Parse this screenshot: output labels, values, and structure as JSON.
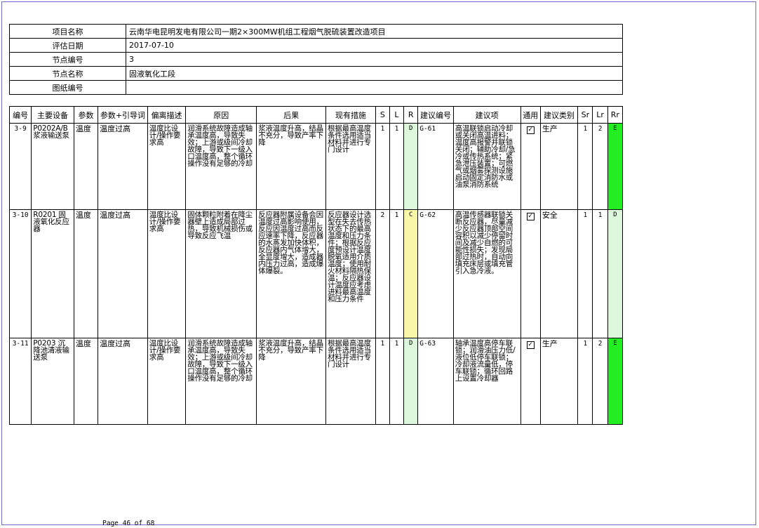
{
  "info": [
    {
      "label": "项目名称",
      "value": "云南华电昆明发电有限公司一期2×300MW机组工程烟气脱硫装置改造项目"
    },
    {
      "label": "评估日期",
      "value": "2017-07-10"
    },
    {
      "label": "节点编号",
      "value": "3"
    },
    {
      "label": "节点名称",
      "value": "固液氧化工段"
    },
    {
      "label": "图纸编号",
      "value": ""
    }
  ],
  "headers": [
    "编号",
    "主要设备",
    "参数",
    "参数+引导词",
    "偏离描述",
    "原因",
    "后果",
    "现有措施",
    "S",
    "L",
    "R",
    "建议编号",
    "建议项",
    "通用",
    "建议类别",
    "Sr",
    "Lr",
    "Rr"
  ],
  "rows": [
    {
      "id": "3-9",
      "equipment": "P0202A/B浆液输送泵",
      "param": "温度",
      "guideword": "温度过高",
      "deviation": "温度比设计/操作要求高",
      "cause": "润滑系统故障造成轴承温度高，导致失效；上游或级间冷却故障，导致下一级入口温度高，整个循环操作没有足够的冷却",
      "consequence": "浆液温度升高，结晶不充分，导致产率下降",
      "measures": "根据最高温度条件选用适当材料并进行专门设计",
      "S": "1",
      "L": "1",
      "R": "D",
      "rec_no": "G-61",
      "recommendation": "高温联锁启动冷却或关闭高温进料；温度高报警并联锁关闭；辅助冷却/急冷或传热系统；紧急泄压装置；可燃气或烟雾探测设施启动固定消防水或油泵消防系统",
      "general": "✓",
      "category": "生产",
      "Sr": "1",
      "Lr": "2",
      "Rr": "E",
      "R_color": "#ddf7dd",
      "Rr_color": "#22ee22"
    },
    {
      "id": "3-10",
      "equipment": "R0201 固液氧化反应器",
      "param": "温度",
      "guideword": "温度过高",
      "deviation": "温度比设计/操作要求高",
      "cause": "固体颗粒附着在降尘器壁上造成局部过热，导致机械损伤或导致反应飞温",
      "consequence": "反应器附属设备会因温度过高影响使用，反应因温度过高而反应速率下降，反应器的水蒸发加快体积，反应器内气体增大，全显度增大，造成器内压力过高，造成爆体爆裂。",
      "measures": "反应器设计选型在失去传热状态下的最高温度和压力条件；根据反应度预设计温度脱氧适用介质温度；使用耐火材料隔热保温；反应器设计温度应考虑进料最高温度和压力条件",
      "S": "2",
      "L": "1",
      "R": "C",
      "rec_no": "G-62",
      "recommendation": "高温传感器联锁关断反应器，尽量减少反应器顶部空间容积以减少停留时间及减少自燃的可能性损失；发现局部过热时，自动向填充床层或填充管引入急冷液。",
      "general": "✓",
      "category": "安全",
      "Sr": "1",
      "Lr": "1",
      "Rr": "D",
      "R_color": "#f8f6a8",
      "Rr_color": "#ddf7dd"
    },
    {
      "id": "3-11",
      "equipment": "P0203 沉降池清液输送泵",
      "param": "温度",
      "guideword": "温度过高",
      "deviation": "温度比设计/操作要求高",
      "cause": "润滑系统故障造成轴承温度高，导致失效；上游或级间冷却故障，导致下一级入口温度高，整个循环操作没有足够的冷却",
      "consequence": "浆液温度升高，结晶不充分，导致产率下降",
      "measures": "根据最高温度条件选用适当材料并进行专门设计",
      "S": "1",
      "L": "1",
      "R": "D",
      "rec_no": "G-63",
      "recommendation": "轴承温度高停车联锁；润滑油压力低/液位低停车联锁；冷却液流量低，停车联锁；循环回路上设置冷却器",
      "general": "✓",
      "category": "生产",
      "Sr": "1",
      "Lr": "2",
      "Rr": "E",
      "R_color": "#ddf7dd",
      "Rr_color": "#22ee22"
    }
  ],
  "footer": "Page 46 of 68"
}
